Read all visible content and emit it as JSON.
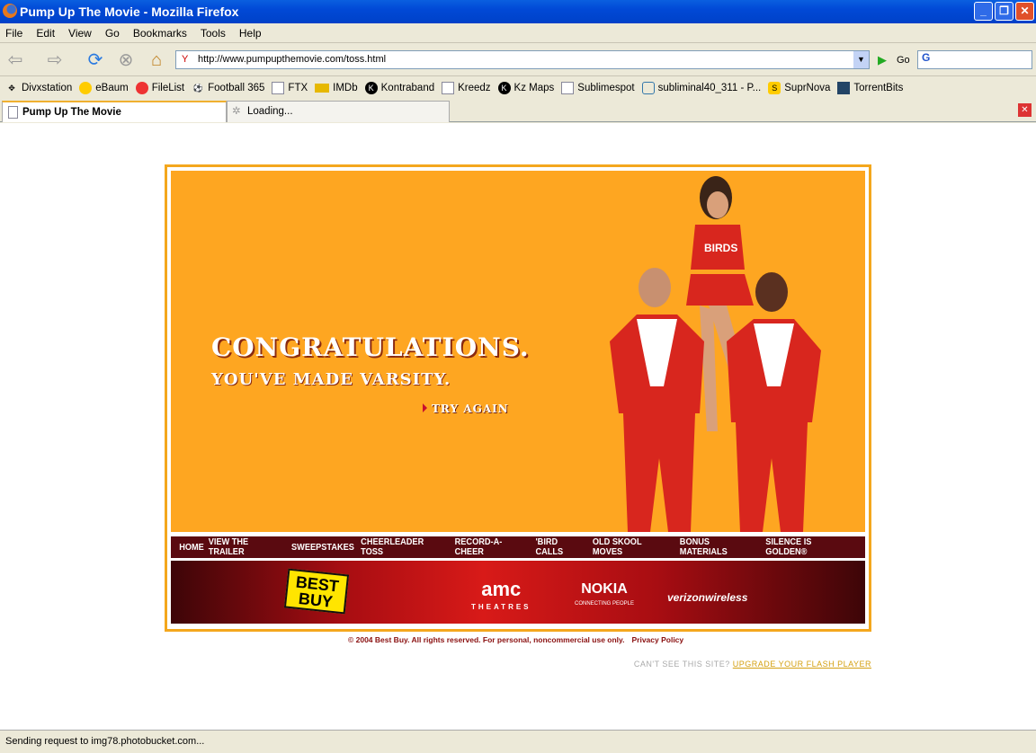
{
  "window": {
    "title": "Pump Up The Movie - Mozilla Firefox"
  },
  "menu": [
    "File",
    "Edit",
    "View",
    "Go",
    "Bookmarks",
    "Tools",
    "Help"
  ],
  "toolbar": {
    "url": "http://www.pumpupthemovie.com/toss.html",
    "go_label": "Go"
  },
  "bookmarks": [
    {
      "label": "Divxstation",
      "icon": "divx-icon"
    },
    {
      "label": "eBaum",
      "icon": "ebaum-icon"
    },
    {
      "label": "FileList",
      "icon": "filelist-icon"
    },
    {
      "label": "Football 365",
      "icon": "football-icon"
    },
    {
      "label": "FTX",
      "icon": "page-icon"
    },
    {
      "label": "IMDb",
      "icon": "imdb-icon"
    },
    {
      "label": "Kontraband",
      "icon": "k-icon"
    },
    {
      "label": "Kreedz",
      "icon": "page-icon"
    },
    {
      "label": "Kz Maps",
      "icon": "k-icon"
    },
    {
      "label": "Sublimespot",
      "icon": "page-icon"
    },
    {
      "label": "subliminal40_311 - P...",
      "icon": "photo-icon"
    },
    {
      "label": "SuprNova",
      "icon": "s-icon"
    },
    {
      "label": "TorrentBits",
      "icon": "tb-icon"
    }
  ],
  "tabs": [
    {
      "label": "Pump Up The Movie",
      "active": true
    },
    {
      "label": "Loading...",
      "active": false
    }
  ],
  "page": {
    "headline": "CONGRATULATIONS.",
    "subhead": "YOU'VE MADE VARSITY.",
    "try_again": "TRY AGAIN",
    "nav": [
      "HOME",
      "VIEW THE TRAILER",
      "SWEEPSTAKES",
      "CHEERLEADER TOSS",
      "RECORD-A-CHEER",
      "'BIRD CALLS",
      "OLD SKOOL MOVES",
      "BONUS MATERIALS",
      "SILENCE IS GOLDEN®"
    ],
    "sponsors": {
      "bestbuy": "BEST BUY",
      "amc": "amc",
      "amc_sub": "THEATRES",
      "nokia": "NOKIA",
      "nokia_sub": "CONNECTING PEOPLE",
      "verizon": "verizonwireless"
    },
    "copyright": "© 2004 Best Buy. All rights reserved. For personal, noncommercial use only.",
    "privacy": "Privacy Policy",
    "flash_prompt": "CAN'T SEE THIS SITE?",
    "flash_link": "UPGRADE YOUR FLASH PLAYER",
    "uniform_text": "BIRDS"
  },
  "status": "Sending request to img78.photobucket.com..."
}
